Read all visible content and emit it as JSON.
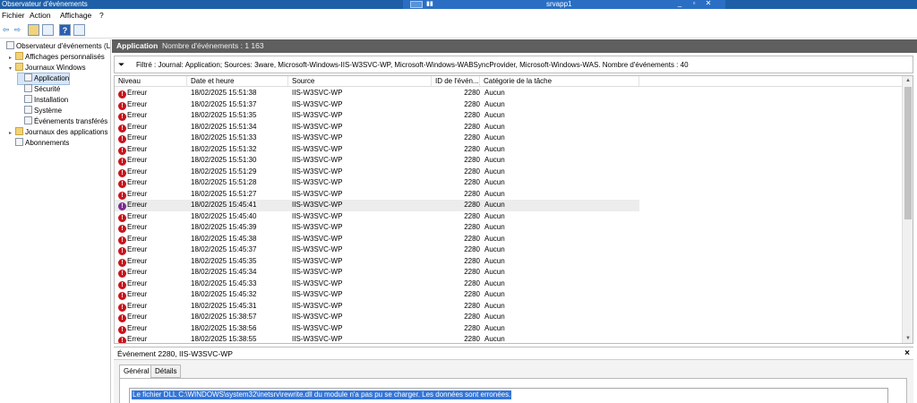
{
  "window": {
    "title": "Observateur d'événements",
    "remote_host": "srvapp1",
    "ctl_min": "_",
    "ctl_restore": "▫",
    "ctl_close": "✕"
  },
  "menu": [
    "Fichier",
    "Action",
    "Affichage",
    "?"
  ],
  "tree": [
    {
      "label": "Observateur d'événements (Loca",
      "indent": 0,
      "expander": "",
      "icon": "log",
      "selected": false
    },
    {
      "label": "Affichages personnalisés",
      "indent": 1,
      "expander": "▸",
      "icon": "folder",
      "selected": false
    },
    {
      "label": "Journaux Windows",
      "indent": 1,
      "expander": "▾",
      "icon": "folder",
      "selected": false
    },
    {
      "label": "Application",
      "indent": 2,
      "expander": "",
      "icon": "log",
      "selected": true
    },
    {
      "label": "Sécurité",
      "indent": 2,
      "expander": "",
      "icon": "log",
      "selected": false
    },
    {
      "label": "Installation",
      "indent": 2,
      "expander": "",
      "icon": "log",
      "selected": false
    },
    {
      "label": "Système",
      "indent": 2,
      "expander": "",
      "icon": "log",
      "selected": false
    },
    {
      "label": "Événements transférés",
      "indent": 2,
      "expander": "",
      "icon": "log",
      "selected": false
    },
    {
      "label": "Journaux des applications et",
      "indent": 1,
      "expander": "▸",
      "icon": "folder",
      "selected": false
    },
    {
      "label": "Abonnements",
      "indent": 1,
      "expander": "",
      "icon": "log",
      "selected": false
    }
  ],
  "main": {
    "log_name": "Application",
    "event_count": "Nombre d'événements : 1 163",
    "filter_text": "Filtré : Journal: Application; Sources: 3ware, Microsoft-Windows-IIS-W3SVC-WP, Microsoft-Windows-WABSyncProvider, Microsoft-Windows-WAS. Nombre d'événements : 40"
  },
  "columns": [
    "Niveau",
    "Date et heure",
    "Source",
    "ID de l'évén...",
    "Catégorie de la tâche"
  ],
  "events": [
    {
      "level": "Erreur",
      "datetime": "18/02/2025 15:51:38",
      "source": "IIS-W3SVC-WP",
      "id": "2280",
      "category": "Aucun"
    },
    {
      "level": "Erreur",
      "datetime": "18/02/2025 15:51:37",
      "source": "IIS-W3SVC-WP",
      "id": "2280",
      "category": "Aucun"
    },
    {
      "level": "Erreur",
      "datetime": "18/02/2025 15:51:35",
      "source": "IIS-W3SVC-WP",
      "id": "2280",
      "category": "Aucun"
    },
    {
      "level": "Erreur",
      "datetime": "18/02/2025 15:51:34",
      "source": "IIS-W3SVC-WP",
      "id": "2280",
      "category": "Aucun"
    },
    {
      "level": "Erreur",
      "datetime": "18/02/2025 15:51:33",
      "source": "IIS-W3SVC-WP",
      "id": "2280",
      "category": "Aucun"
    },
    {
      "level": "Erreur",
      "datetime": "18/02/2025 15:51:32",
      "source": "IIS-W3SVC-WP",
      "id": "2280",
      "category": "Aucun"
    },
    {
      "level": "Erreur",
      "datetime": "18/02/2025 15:51:30",
      "source": "IIS-W3SVC-WP",
      "id": "2280",
      "category": "Aucun"
    },
    {
      "level": "Erreur",
      "datetime": "18/02/2025 15:51:29",
      "source": "IIS-W3SVC-WP",
      "id": "2280",
      "category": "Aucun"
    },
    {
      "level": "Erreur",
      "datetime": "18/02/2025 15:51:28",
      "source": "IIS-W3SVC-WP",
      "id": "2280",
      "category": "Aucun"
    },
    {
      "level": "Erreur",
      "datetime": "18/02/2025 15:51:27",
      "source": "IIS-W3SVC-WP",
      "id": "2280",
      "category": "Aucun"
    },
    {
      "level": "Erreur",
      "datetime": "18/02/2025 15:45:41",
      "source": "IIS-W3SVC-WP",
      "id": "2280",
      "category": "Aucun",
      "selected": true
    },
    {
      "level": "Erreur",
      "datetime": "18/02/2025 15:45:40",
      "source": "IIS-W3SVC-WP",
      "id": "2280",
      "category": "Aucun"
    },
    {
      "level": "Erreur",
      "datetime": "18/02/2025 15:45:39",
      "source": "IIS-W3SVC-WP",
      "id": "2280",
      "category": "Aucun"
    },
    {
      "level": "Erreur",
      "datetime": "18/02/2025 15:45:38",
      "source": "IIS-W3SVC-WP",
      "id": "2280",
      "category": "Aucun"
    },
    {
      "level": "Erreur",
      "datetime": "18/02/2025 15:45:37",
      "source": "IIS-W3SVC-WP",
      "id": "2280",
      "category": "Aucun"
    },
    {
      "level": "Erreur",
      "datetime": "18/02/2025 15:45:35",
      "source": "IIS-W3SVC-WP",
      "id": "2280",
      "category": "Aucun"
    },
    {
      "level": "Erreur",
      "datetime": "18/02/2025 15:45:34",
      "source": "IIS-W3SVC-WP",
      "id": "2280",
      "category": "Aucun"
    },
    {
      "level": "Erreur",
      "datetime": "18/02/2025 15:45:33",
      "source": "IIS-W3SVC-WP",
      "id": "2280",
      "category": "Aucun"
    },
    {
      "level": "Erreur",
      "datetime": "18/02/2025 15:45:32",
      "source": "IIS-W3SVC-WP",
      "id": "2280",
      "category": "Aucun"
    },
    {
      "level": "Erreur",
      "datetime": "18/02/2025 15:45:31",
      "source": "IIS-W3SVC-WP",
      "id": "2280",
      "category": "Aucun"
    },
    {
      "level": "Erreur",
      "datetime": "18/02/2025 15:38:57",
      "source": "IIS-W3SVC-WP",
      "id": "2280",
      "category": "Aucun"
    },
    {
      "level": "Erreur",
      "datetime": "18/02/2025 15:38:56",
      "source": "IIS-W3SVC-WP",
      "id": "2280",
      "category": "Aucun"
    },
    {
      "level": "Erreur",
      "datetime": "18/02/2025 15:38:55",
      "source": "IIS-W3SVC-WP",
      "id": "2280",
      "category": "Aucun"
    }
  ],
  "detail": {
    "title": "Événement 2280, IIS-W3SVC-WP",
    "tabs": [
      "Général",
      "Détails"
    ],
    "message": "Le fichier DLL C:\\WINDOWS\\system32\\inetsrv\\rewrite.dll du module n'a pas pu se charger. Les données sont erronées."
  },
  "colors": {
    "error": "#c8141c",
    "titlebar": "#1f5fa8",
    "selection": "#3375d7"
  }
}
